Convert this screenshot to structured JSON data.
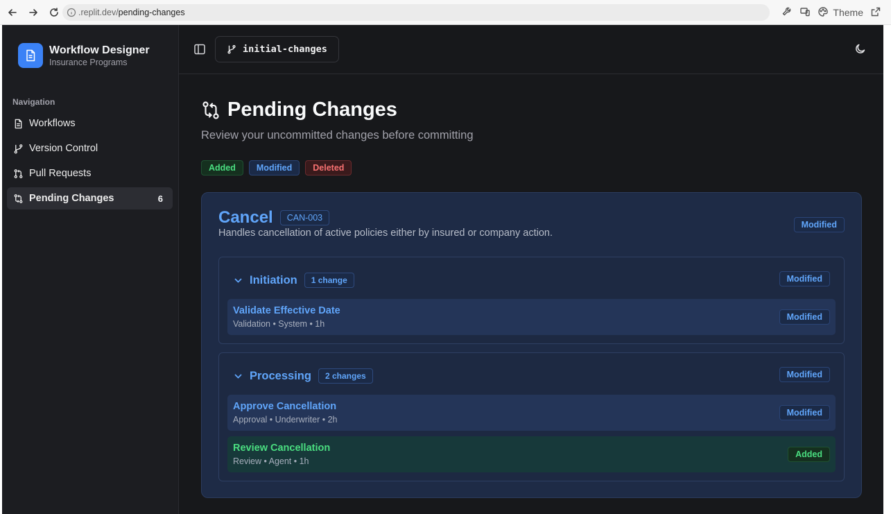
{
  "browser": {
    "url_host": ".replit.dev/",
    "url_path": "pending-changes",
    "theme_label": "Theme"
  },
  "brand": {
    "title": "Workflow Designer",
    "subtitle": "Insurance Programs",
    "logo_icon": "document-icon",
    "accent": "#3b82f6"
  },
  "sidebar": {
    "heading": "Navigation",
    "items": [
      {
        "label": "Workflows",
        "icon": "document-icon",
        "active": false
      },
      {
        "label": "Version Control",
        "icon": "git-branch-icon",
        "active": false
      },
      {
        "label": "Pull Requests",
        "icon": "git-pull-request-icon",
        "active": false
      },
      {
        "label": "Pending Changes",
        "icon": "git-compare-icon",
        "active": true,
        "count": "6"
      }
    ]
  },
  "topbar": {
    "branch": "initial-changes"
  },
  "page": {
    "title": "Pending Changes",
    "subtitle": "Review your uncommitted changes before committing",
    "legend": {
      "added": "Added",
      "modified": "Modified",
      "deleted": "Deleted"
    }
  },
  "workflow": {
    "name": "Cancel",
    "code": "CAN-003",
    "description": "Handles cancellation of active policies either by insured or company action.",
    "status": "Modified",
    "stages": [
      {
        "name": "Initiation",
        "count": "1 change",
        "status": "Modified",
        "steps": [
          {
            "title": "Validate Effective Date",
            "meta": "Validation • System • 1h",
            "status": "Modified"
          }
        ]
      },
      {
        "name": "Processing",
        "count": "2 changes",
        "status": "Modified",
        "steps": [
          {
            "title": "Approve Cancellation",
            "meta": "Approval • Underwriter • 2h",
            "status": "Modified"
          },
          {
            "title": "Review Cancellation",
            "meta": "Review • Agent • 1h",
            "status": "Added"
          }
        ]
      }
    ]
  },
  "colors": {
    "added": "#4ade80",
    "modified": "#60a5fa",
    "deleted": "#f87171"
  }
}
